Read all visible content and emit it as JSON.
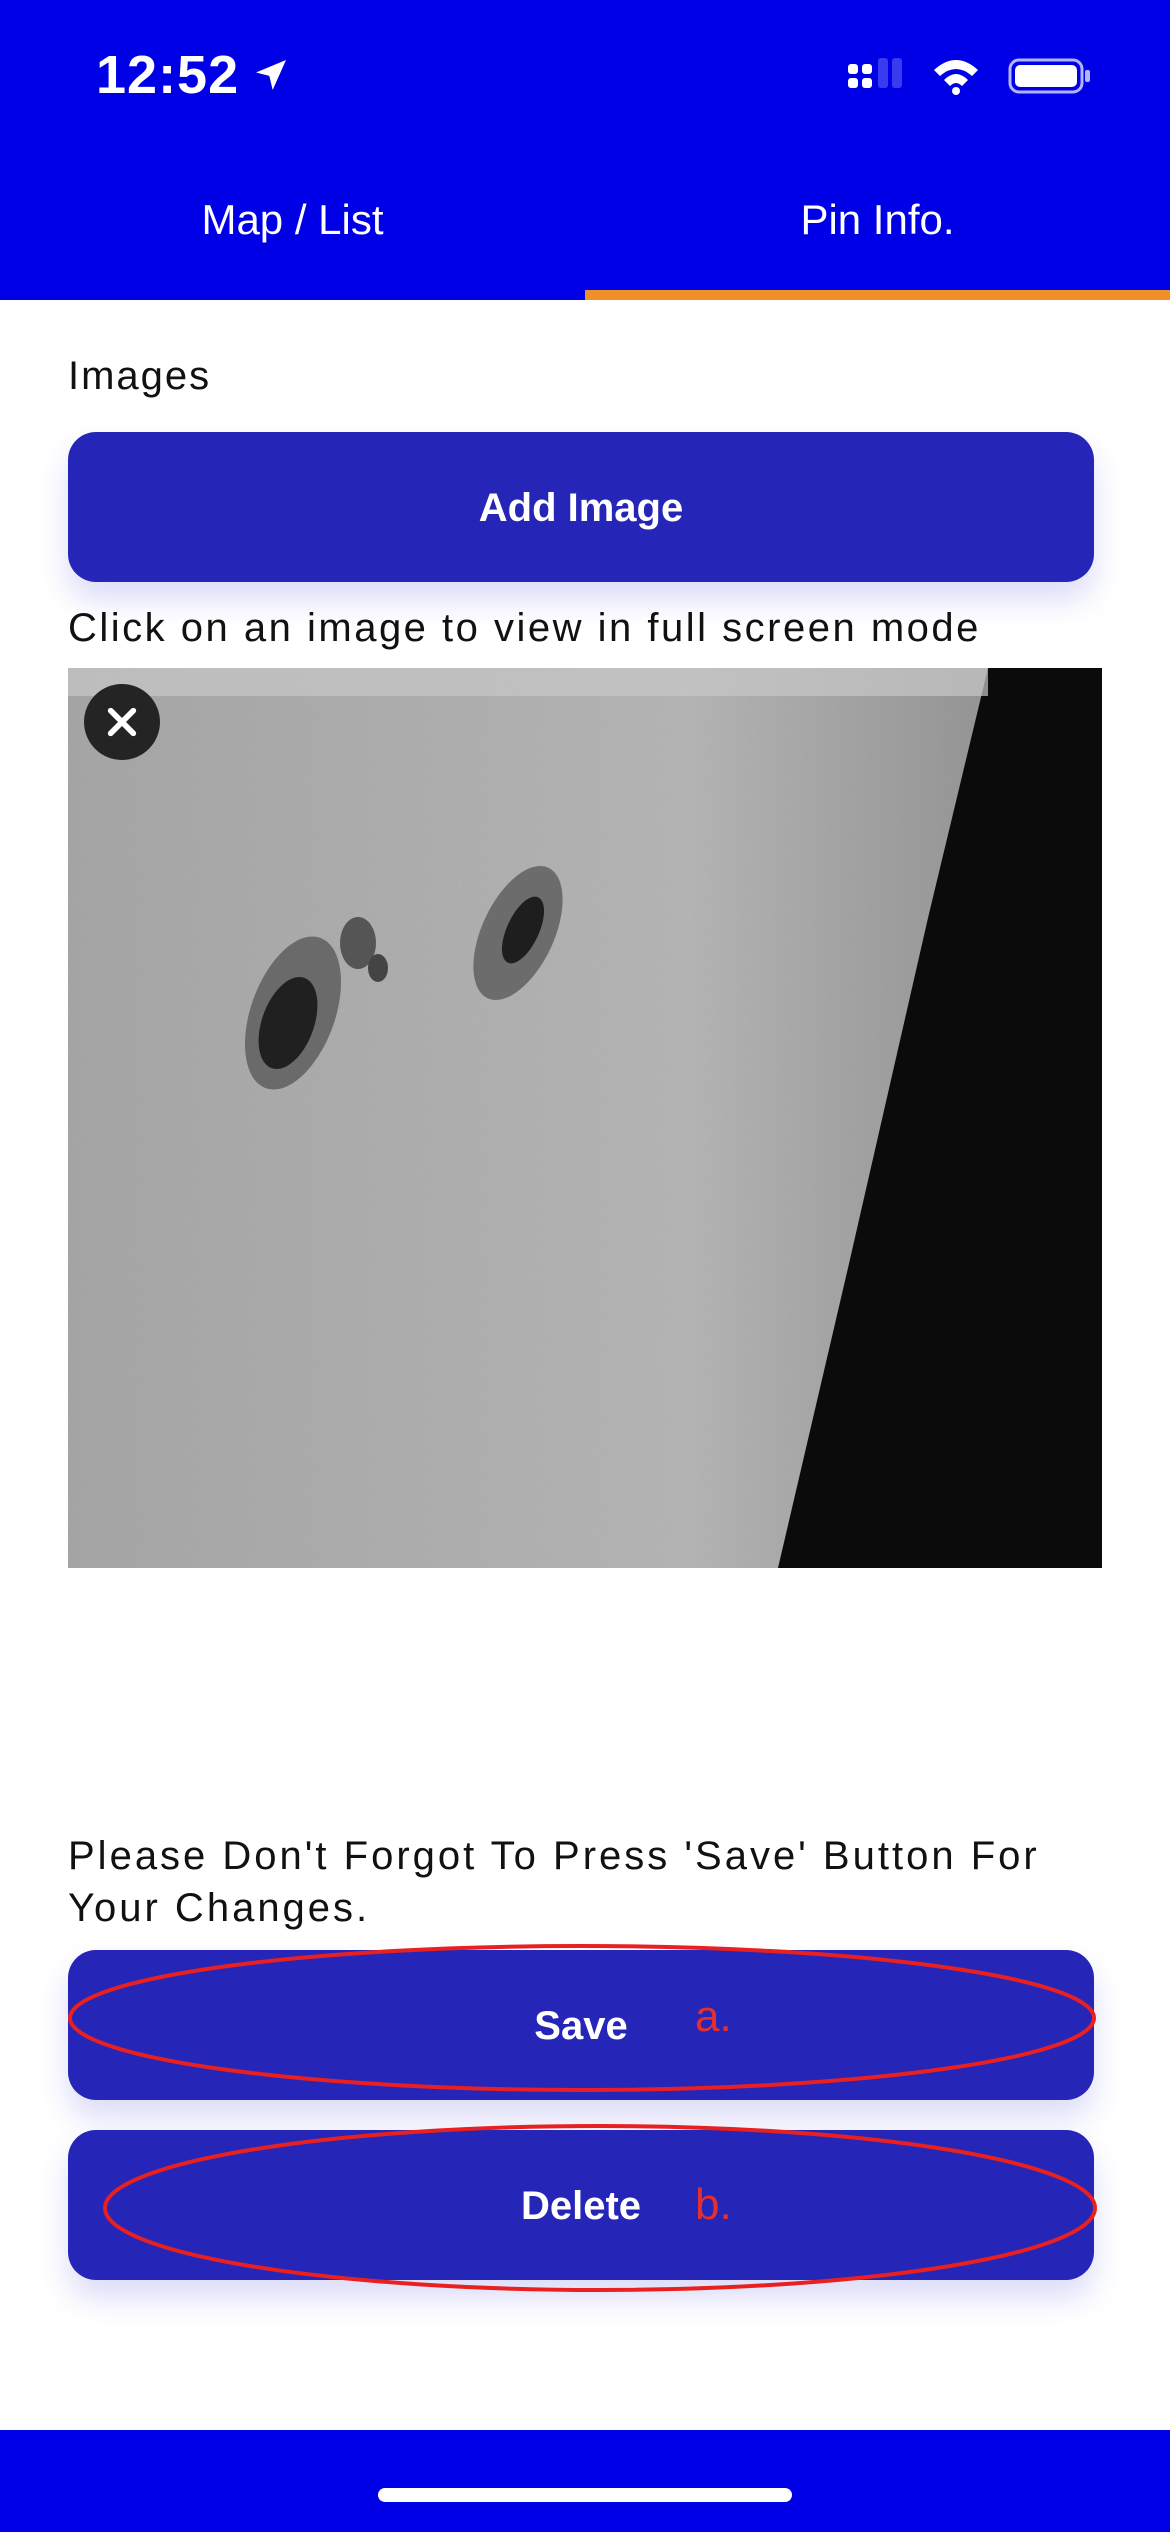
{
  "status_bar": {
    "time": "12:52",
    "icons": [
      "location-arrow-icon",
      "signal-icon",
      "wifi-icon",
      "battery-icon"
    ]
  },
  "tabs": [
    {
      "label": "Map / List",
      "active": false
    },
    {
      "label": "Pin Info.",
      "active": true
    }
  ],
  "images_section": {
    "title": "Images",
    "add_button_label": "Add Image",
    "hint": "Click on an image to view in full screen mode",
    "image_description": "sunspots-on-solar-surface"
  },
  "reminder": "Please Don't Forgot To Press 'Save' Button For Your Changes.",
  "actions": {
    "save_label": "Save",
    "delete_label": "Delete"
  },
  "annotations": {
    "save_mark": "a.",
    "delete_mark": "b."
  },
  "colors": {
    "header": "#0000e6",
    "button": "#2525b8",
    "tab_indicator": "#f0902a",
    "annotation": "#e23030"
  }
}
